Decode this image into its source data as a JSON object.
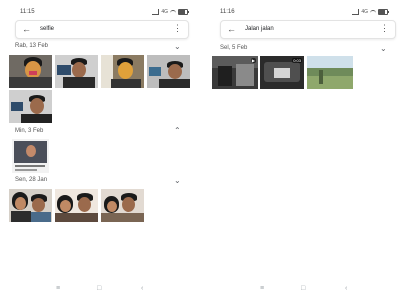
{
  "left": {
    "status": {
      "time": "11:15",
      "network": "4G"
    },
    "search": {
      "query": "selfie",
      "back_icon": "arrow-left-icon",
      "more_icon": "more-vert-icon"
    },
    "sections": [
      {
        "label": "Rab, 13 Feb"
      },
      {
        "label": "Min, 3 Feb"
      },
      {
        "label": "Sen, 28 Jan"
      }
    ]
  },
  "right": {
    "status": {
      "time": "11:16",
      "network": "4G"
    },
    "search": {
      "query": "Jalan jalan",
      "back_icon": "arrow-left-icon",
      "more_icon": "more-vert-icon"
    },
    "sections": [
      {
        "label": "Sel, 5 Feb"
      }
    ],
    "video_badge": "0:03"
  },
  "navbar": {
    "recents_icon": "recents-icon",
    "home_icon": "home-icon",
    "back_icon": "back-icon"
  }
}
